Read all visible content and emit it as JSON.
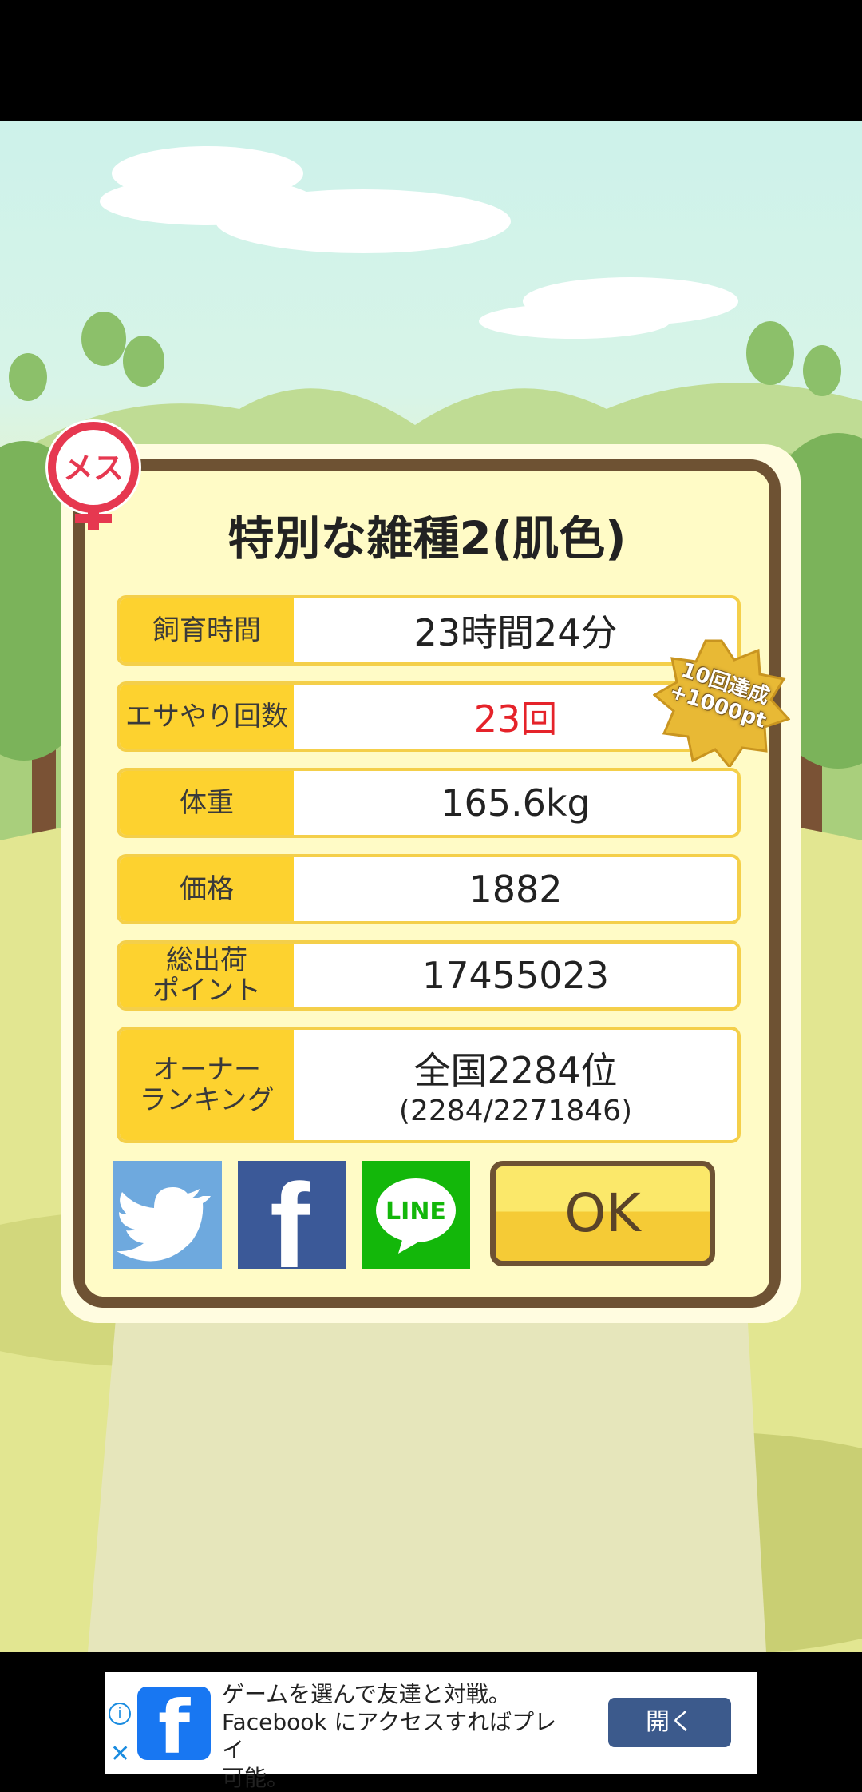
{
  "colors": {
    "sky": "#cdf2ea",
    "dialog_border": "#6e5233",
    "dialog_fill": "#fffbc6",
    "label_fill": "#fdd22f",
    "highlight_red": "#e5232a",
    "twitter": "#6ea9de",
    "facebook": "#3b5998",
    "line": "#13b70a",
    "ad_button": "#3c5a8c"
  },
  "gender_badge": {
    "label": "メス",
    "icon": "female-symbol-icon"
  },
  "dialog": {
    "title": "特別な雑種2(肌色)",
    "rows": [
      {
        "label": "飼育時間",
        "value": "23時間24分"
      },
      {
        "label": "エサやり回数",
        "value": "23回",
        "highlight": true
      },
      {
        "label": "体重",
        "value": "165.6kg"
      },
      {
        "label": "価格",
        "value": "1882"
      },
      {
        "label": "総出荷\nポイント",
        "value": "17455023"
      },
      {
        "label": "オーナー\nランキング",
        "value": "全国2284位",
        "sub": "(2284/2271846)"
      }
    ],
    "achievement_badge": "10回達成\n+1000pt",
    "share": {
      "twitter_icon": "twitter-bird-icon",
      "facebook_label": "f",
      "line_label": "LINE"
    },
    "ok_label": "OK"
  },
  "ad": {
    "logo": "f",
    "text": "ゲームを選んで友達と対戦。\nFacebook にアクセスすればプレイ\n可能。",
    "button": "開く",
    "info_label": "i",
    "close_label": "✕"
  }
}
